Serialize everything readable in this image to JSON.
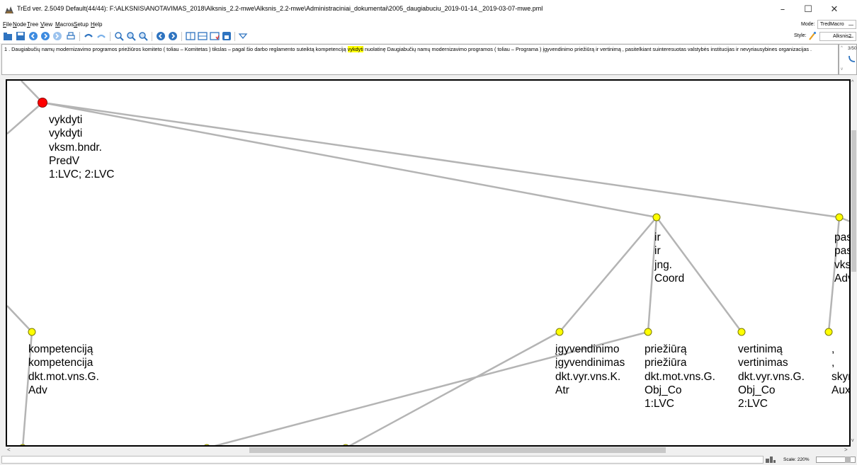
{
  "window": {
    "title": "TrEd ver. 2.5049   Default(44/44): F:\\ALKSNIS\\ANOTAVIMAS_2018\\Alksnis_2.2-mwe\\Alksnis_2.2-mwe\\Administraciniai_dokumentai\\2005_daugiabuciu_2019-01-14._2019-03-07-mwe.pml",
    "minimize": "–",
    "maximize": "☐",
    "close": "✕"
  },
  "menu": {
    "items": [
      "File",
      "Node",
      "Tree",
      "View",
      "Macros",
      "Setup",
      "Help"
    ],
    "mode_label": "Mode:",
    "mode_value": "TredMacro"
  },
  "toolbar": {
    "style_label": "Style:",
    "style_value": "Alksnis2"
  },
  "sentence": {
    "before": "1 . Daugiabučių namų modernizavimo programos priežiūros komiteto ( toliau – Komitetas ) tikslas – pagal šio darbo reglamento suteiktą kompetenciją ",
    "highlight": "vykdyti",
    "after": " nuolatinę Daugiabučių namų modernizavimo programos ( toliau – Programa ) įgyvendinimo priežiūrą ir vertinimą , pasitelkiant suinteresuotas valstybės institucijas ir nevyriausybines organizacijas .",
    "page_count": "3/50"
  },
  "tree": {
    "nodes": [
      {
        "id": "vykdyti",
        "lines": [
          "vykdyti",
          "vykdyti",
          "vksm.bndr.",
          "PredV",
          "1:LVC; 2:LVC"
        ]
      },
      {
        "id": "ir",
        "lines": [
          "ir",
          "ir",
          "jng.",
          "Coord"
        ]
      },
      {
        "id": "pasitelkiant",
        "lines": [
          "pas",
          "pas",
          "vks",
          "Adv"
        ]
      },
      {
        "id": "kompetencija",
        "lines": [
          "kompetenciją",
          "kompetencija",
          "dkt.mot.vns.G.",
          "Adv"
        ]
      },
      {
        "id": "igyvendinimo",
        "lines": [
          "įgyvendinimo",
          "įgyvendinimas",
          "dkt.vyr.vns.K.",
          "Atr"
        ]
      },
      {
        "id": "prieziura",
        "lines": [
          "priežiūrą",
          "priežiūra",
          "dkt.mot.vns.G.",
          "Obj_Co",
          "1:LVC"
        ]
      },
      {
        "id": "vertinima",
        "lines": [
          "vertinimą",
          "vertinimas",
          "dkt.vyr.vns.G.",
          "Obj_Co",
          "2:LVC"
        ]
      },
      {
        "id": "comma",
        "lines": [
          ",",
          ",",
          "skyr.",
          "Aux"
        ]
      }
    ],
    "colors": {
      "selected": "#ff0000",
      "node": "#ffff00",
      "edge": "#b4b4b4"
    }
  },
  "status": {
    "scale_label": "Scale: 220%"
  },
  "icons": [
    "app-icon",
    "open-icon",
    "save-icon",
    "prev-icon",
    "next-icon",
    "print-icon",
    "undo-icon",
    "redo-icon",
    "zoom-icon",
    "zoom-in-icon",
    "zoom-out-icon",
    "back-icon",
    "forward-icon",
    "view-icon",
    "layout-icon",
    "check-icon",
    "lock-icon",
    "dropdown-icon"
  ]
}
